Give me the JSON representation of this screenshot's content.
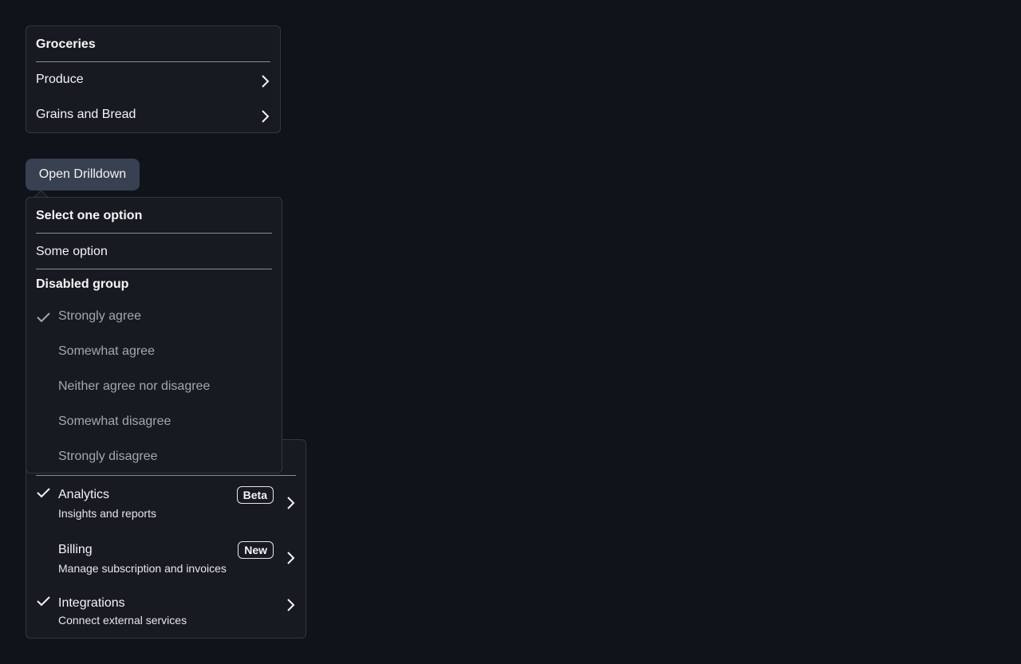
{
  "groceries_menu": {
    "title": "Groceries",
    "items": [
      {
        "label": "Produce",
        "icon": "chevron-right-icon"
      },
      {
        "label": "Grains and Bread",
        "icon": "chevron-right-icon"
      }
    ]
  },
  "drilldown_button": {
    "label": "Open Drilldown"
  },
  "select_menu": {
    "title": "Select one option",
    "option": "Some option",
    "group_title": "Disabled group",
    "group_options": [
      {
        "label": "Strongly agree",
        "checked": true
      },
      {
        "label": "Somewhat agree",
        "checked": false
      },
      {
        "label": "Neither agree nor disagree",
        "checked": false
      },
      {
        "label": "Somewhat disagree",
        "checked": false
      },
      {
        "label": "Strongly disagree",
        "checked": false
      }
    ]
  },
  "features_menu": {
    "items": [
      {
        "title": "Analytics",
        "subtitle": "Insights and reports",
        "badge": "Beta",
        "checked": true
      },
      {
        "title": "Billing",
        "subtitle": "Manage subscription and invoices",
        "badge": "New",
        "checked": false
      },
      {
        "title": "Integrations",
        "subtitle": "Connect external services",
        "checked": true
      }
    ]
  },
  "colors": {
    "background": "#11131b",
    "panel": "#181a21",
    "border": "#343743",
    "button": "#374151",
    "text": "#f3f4f6",
    "disabled_text": "#a4a7ae"
  }
}
